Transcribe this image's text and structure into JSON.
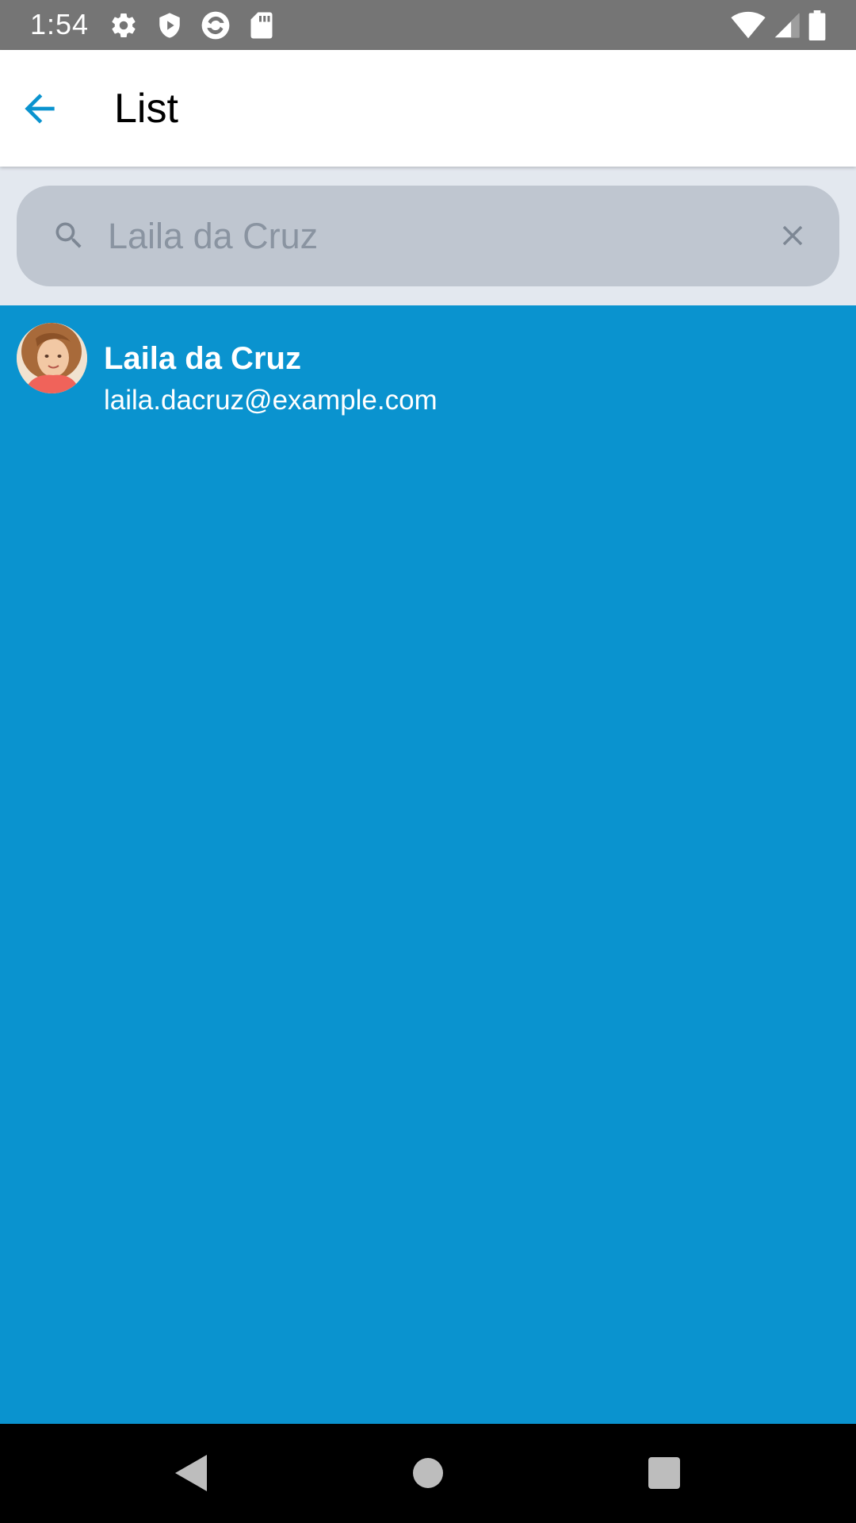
{
  "status_bar": {
    "time": "1:54",
    "left_icons": [
      "settings-icon",
      "shield-icon",
      "sync-icon",
      "sd-card-icon"
    ],
    "right_icons": [
      "wifi-icon",
      "cell-signal-icon",
      "battery-icon"
    ]
  },
  "app_bar": {
    "back_icon": "arrow-back-icon",
    "title": "List"
  },
  "search": {
    "placeholder": "Laila da Cruz",
    "value": "",
    "search_icon": "search-icon",
    "clear_icon": "close-icon"
  },
  "results": [
    {
      "name": "Laila da Cruz",
      "email": "laila.dacruz@example.com",
      "avatar": "avatar-photo"
    }
  ],
  "nav_bar": {
    "buttons": [
      "nav-back-icon",
      "nav-home-icon",
      "nav-recents-icon"
    ]
  },
  "colors": {
    "accent": "#0a93cf",
    "status_bar": "#757575",
    "search_box": "#bfc6d0",
    "search_area": "#e3e8ef"
  }
}
